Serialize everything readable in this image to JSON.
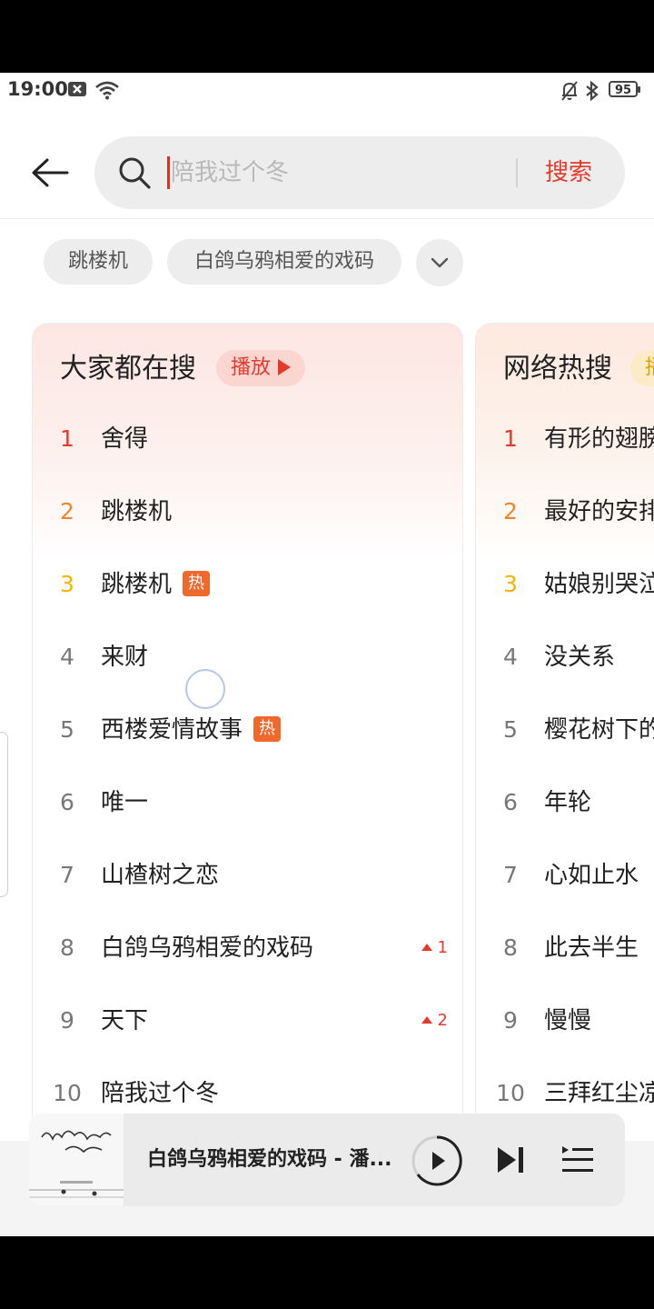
{
  "status_bar": {
    "time": "19:00",
    "battery": "95"
  },
  "search": {
    "placeholder": "陪我过个冬",
    "button_label": "搜索"
  },
  "history_chips": [
    "跳楼机",
    "白鸽乌鸦相爱的戏码"
  ],
  "cards": [
    {
      "title": "大家都在搜",
      "play_label": "播放",
      "items": [
        {
          "rank": "1",
          "name": "舍得"
        },
        {
          "rank": "2",
          "name": "跳楼机"
        },
        {
          "rank": "3",
          "name": "跳楼机",
          "badge": "热"
        },
        {
          "rank": "4",
          "name": "来财"
        },
        {
          "rank": "5",
          "name": "西楼爱情故事",
          "badge": "热"
        },
        {
          "rank": "6",
          "name": "唯一"
        },
        {
          "rank": "7",
          "name": "山楂树之恋"
        },
        {
          "rank": "8",
          "name": "白鸽乌鸦相爱的戏码",
          "trend": "1"
        },
        {
          "rank": "9",
          "name": "天下",
          "trend": "2"
        },
        {
          "rank": "10",
          "name": "陪我过个冬"
        }
      ]
    },
    {
      "title": "网络热搜",
      "play_label": "播",
      "items": [
        {
          "rank": "1",
          "name": "有形的翅膀"
        },
        {
          "rank": "2",
          "name": "最好的安排"
        },
        {
          "rank": "3",
          "name": "姑娘别哭泣"
        },
        {
          "rank": "4",
          "name": "没关系"
        },
        {
          "rank": "5",
          "name": "樱花树下的"
        },
        {
          "rank": "6",
          "name": "年轮"
        },
        {
          "rank": "7",
          "name": "心如止水"
        },
        {
          "rank": "8",
          "name": "此去半生"
        },
        {
          "rank": "9",
          "name": "慢慢"
        },
        {
          "rank": "10",
          "name": "三拜红尘凉"
        }
      ]
    }
  ],
  "player": {
    "title": "白鸽乌鸦相爱的戏码 - 潘..."
  },
  "colors": {
    "accent": "#e33a2c",
    "rank2": "#f0862c",
    "rank3": "#f4b400",
    "hot_badge": "#f0682c"
  }
}
